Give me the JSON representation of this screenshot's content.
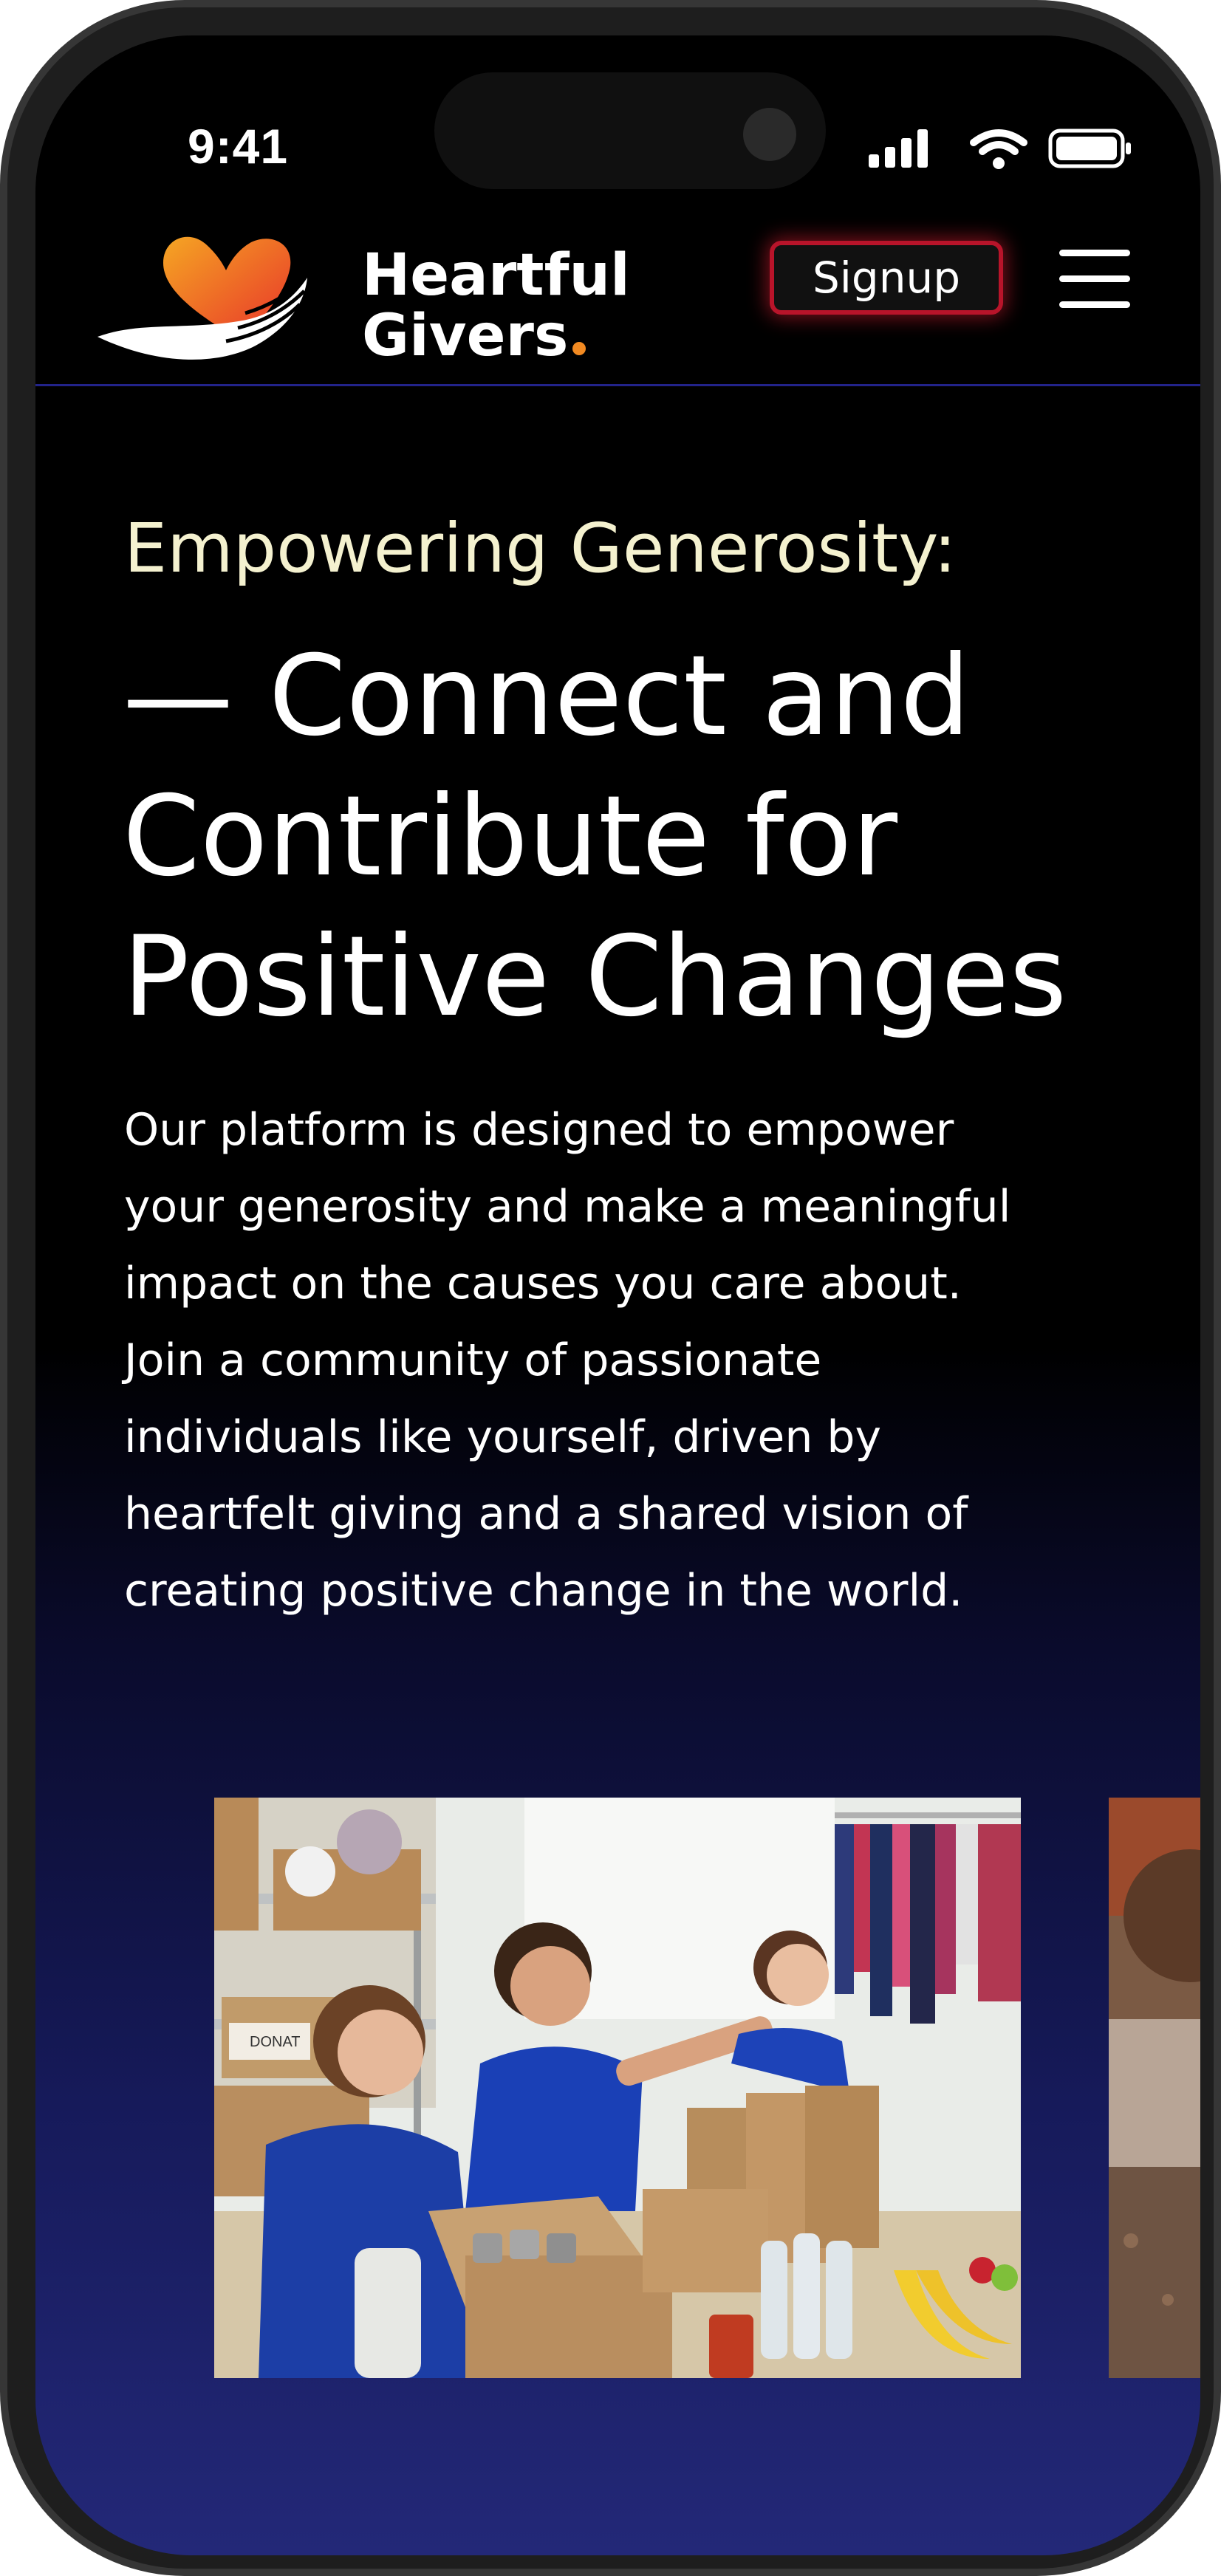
{
  "status_bar": {
    "time": "9:41",
    "icons": [
      "signal-icon",
      "wifi-icon",
      "battery-icon"
    ]
  },
  "header": {
    "brand_line1": "Heartful",
    "brand_line2": "Givers",
    "signup_label": "Signup",
    "menu_icon": "hamburger-menu-icon"
  },
  "hero": {
    "eyebrow": "Empowering Generosity:",
    "headline": " — Connect and\nContribute for\nPositive Changes",
    "body": "Our platform is designed to empower\nyour generosity and make a meaningful\nimpact on the causes you care about.\nJoin a community of passionate\nindividuals like yourself, driven by\nheartfelt giving and a shared vision of\ncreating positive change in the world."
  },
  "carousel": {
    "slides": [
      {
        "subject": "volunteers-packing-donations-photo",
        "box_label": "DONAT"
      },
      {
        "subject": "child-portrait-photo"
      }
    ]
  },
  "colors": {
    "accent_red": "#b8142a",
    "eyebrow": "#f4f1cf",
    "divider": "#22238a",
    "gradient_end": "#232878",
    "logo_heart": "#f0562c"
  }
}
